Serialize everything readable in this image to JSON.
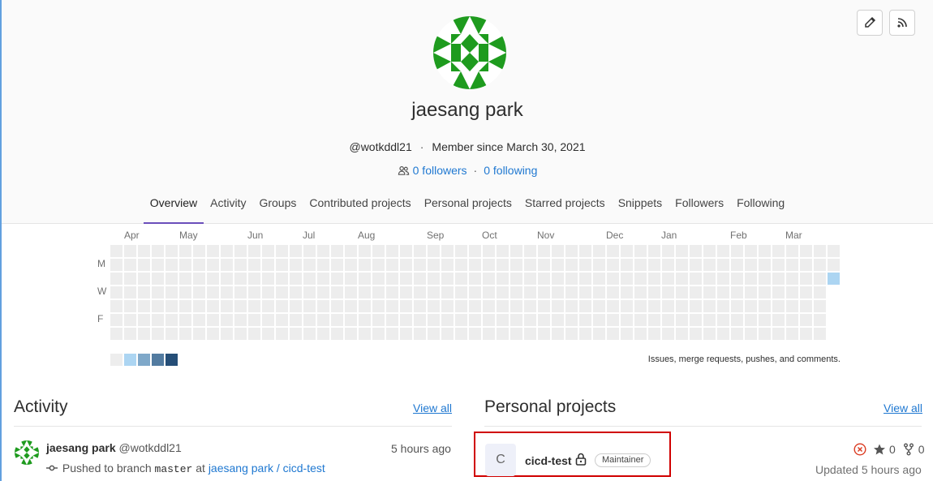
{
  "header": {
    "edit_icon": "pencil-icon",
    "rss_icon": "rss-icon",
    "name": "jaesang park",
    "username": "@wotkddl21",
    "member_since": "Member since March 30, 2021",
    "followers": "0 followers",
    "following": "0 following",
    "separator": "·"
  },
  "tabs": [
    {
      "label": "Overview",
      "active": true
    },
    {
      "label": "Activity"
    },
    {
      "label": "Groups"
    },
    {
      "label": "Contributed projects"
    },
    {
      "label": "Personal projects"
    },
    {
      "label": "Starred projects"
    },
    {
      "label": "Snippets"
    },
    {
      "label": "Followers"
    },
    {
      "label": "Following"
    }
  ],
  "calendar": {
    "months": [
      "Apr",
      "May",
      "Jun",
      "Jul",
      "Aug",
      "Sep",
      "Oct",
      "Nov",
      "Dec",
      "Jan",
      "Feb",
      "Mar"
    ],
    "days": [
      "M",
      "W",
      "F"
    ],
    "hint": "Issues, merge requests, pushes, and comments.",
    "colors": {
      "empty": "#ededed",
      "level1": "#acd5f2",
      "level2": "#7fa8c9",
      "level3": "#527ba0",
      "level4": "#254e77"
    },
    "active_day": {
      "week": 52,
      "day": 2,
      "level": 1
    }
  },
  "activity": {
    "title": "Activity",
    "view_all": "View all",
    "item": {
      "user": "jaesang park",
      "handle": "@wotkddl21",
      "time": "5 hours ago",
      "action": "Pushed to branch",
      "branch": "master",
      "at": "at",
      "project_link": "jaesang park / cicd-test"
    }
  },
  "projects": {
    "title": "Personal projects",
    "view_all": "View all",
    "item": {
      "initial": "C",
      "name": "cicd-test",
      "role": "Maintainer",
      "stars": "0",
      "forks": "0",
      "updated": "Updated 5 hours ago"
    }
  }
}
